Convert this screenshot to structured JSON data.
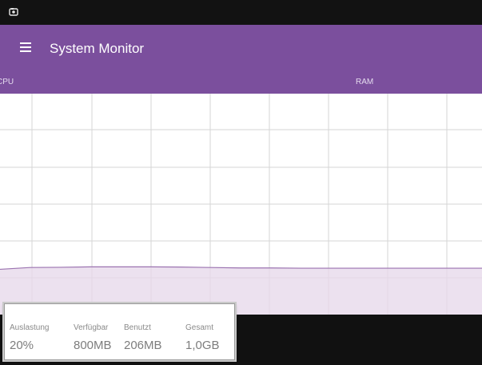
{
  "app": {
    "title": "System Monitor"
  },
  "tabs": [
    {
      "label": "CPU",
      "active": true
    },
    {
      "label": "RAM",
      "active": false
    }
  ],
  "stats": {
    "load_label": "Auslastung",
    "load_value": "20%",
    "free_label": "Verfügbar",
    "free_value": "800MB",
    "used_label": "Benutzt",
    "used_value": "206MB",
    "total_label": "Gesamt",
    "total_value": "1,0GB"
  },
  "icons": {
    "status": "notification-icon",
    "menu": "menu-icon"
  },
  "colors": {
    "status_bar": "#121212",
    "toolbar": "#7b4f9d",
    "tab_text": "#e5dcef",
    "chart_fill": "#e7d9ea",
    "chart_line": "#9b73b0",
    "grid": "#d6d6d6",
    "background": "#ffffff"
  },
  "chart_data": {
    "type": "area",
    "title": "",
    "xlabel": "",
    "ylabel": "",
    "ylim": [
      0,
      100
    ],
    "grid": true,
    "series": [
      {
        "values": [
          20.5,
          21.3,
          21.4,
          21.6,
          21.6,
          21.6,
          21.5,
          21.3,
          21.1,
          21.1,
          21.0,
          21.0,
          21.0,
          21.0,
          21.0,
          21.0,
          21.0
        ]
      }
    ]
  }
}
